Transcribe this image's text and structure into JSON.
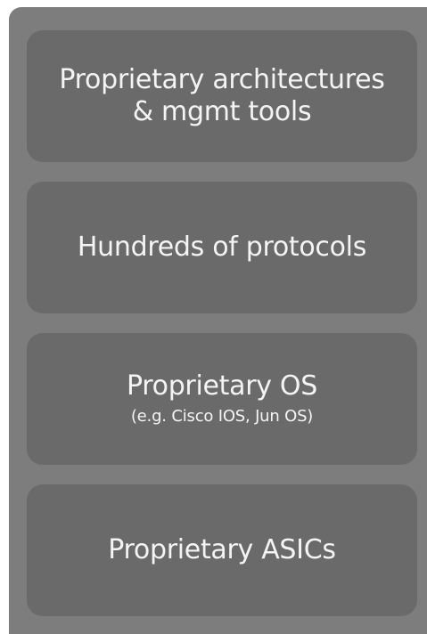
{
  "layers": [
    {
      "line1": "Proprietary architectures",
      "line2": "& mgmt tools"
    },
    {
      "title": "Hundreds of protocols"
    },
    {
      "title": "Proprietary OS",
      "subtitle": "(e.g. Cisco IOS, Jun OS)"
    },
    {
      "title": "Proprietary ASICs"
    }
  ],
  "colors": {
    "outer_panel": "#7d7d7d",
    "layer_box": "#6a6a6a",
    "text": "#f4f4f4"
  }
}
